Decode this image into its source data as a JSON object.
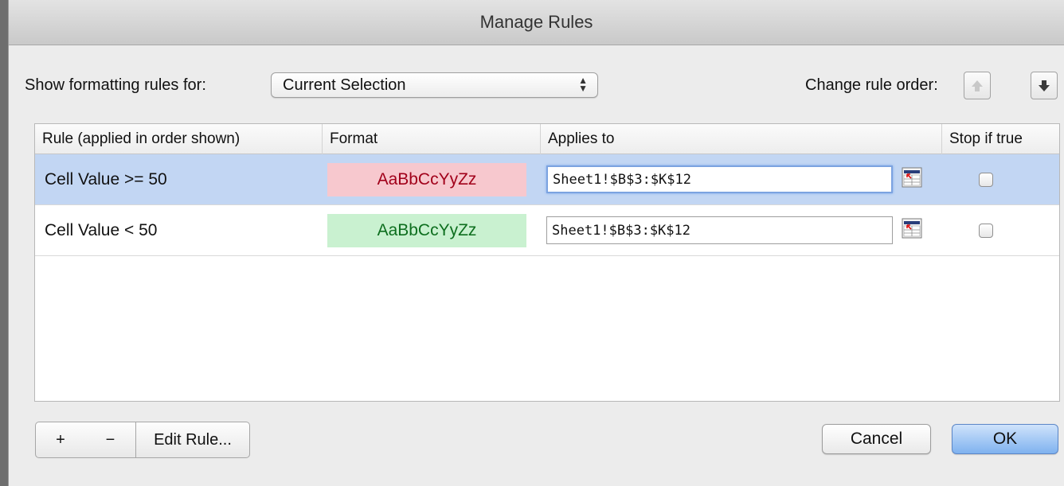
{
  "window": {
    "title": "Manage Rules"
  },
  "header": {
    "show_label": "Show formatting rules for:",
    "show_select_value": "Current Selection",
    "order_label": "Change rule order:"
  },
  "table": {
    "columns": [
      "Rule (applied in order shown)",
      "Format",
      "Applies to",
      "Stop if true"
    ],
    "rows": [
      {
        "rule": "Cell Value >= 50",
        "format_preview": "AaBbCcYyZz",
        "format_color": "red",
        "applies_to": "Sheet1!$B$3:$K$12",
        "stop_if_true": false,
        "selected": true
      },
      {
        "rule": "Cell Value < 50",
        "format_preview": "AaBbCcYyZz",
        "format_color": "green",
        "applies_to": "Sheet1!$B$3:$K$12",
        "stop_if_true": false,
        "selected": false
      }
    ]
  },
  "footer": {
    "add_label": "+",
    "remove_label": "−",
    "edit_label": "Edit Rule...",
    "cancel_label": "Cancel",
    "ok_label": "OK"
  },
  "colors": {
    "selected_row": "#c2d6f3",
    "red_format_bg": "#f7c8ce",
    "red_format_text": "#a1001a",
    "green_format_bg": "#c9f1d0",
    "green_format_text": "#0d6e1e",
    "ok_button": "#7fb2ef"
  },
  "icons": [
    "up-arrow-icon",
    "down-arrow-icon",
    "select-arrows-icon",
    "range-picker-icon"
  ]
}
